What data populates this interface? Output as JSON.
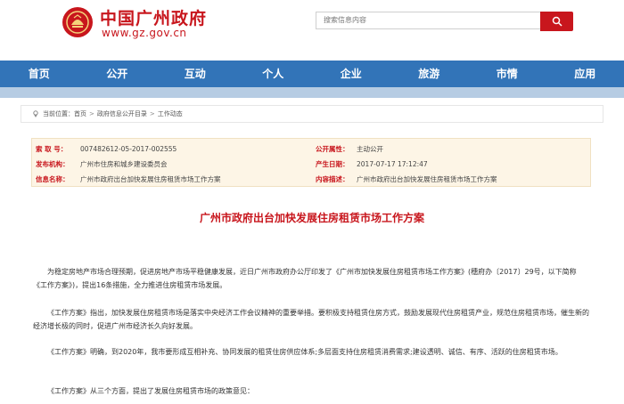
{
  "header": {
    "site_name": "中国广州政府",
    "site_url": "www.gz.gov.cn",
    "search_placeholder": "搜索信息内容"
  },
  "nav": {
    "items": [
      "首页",
      "公开",
      "互动",
      "个人",
      "企业",
      "旅游",
      "市情",
      "应用"
    ]
  },
  "breadcrumb": {
    "label": "当前位置：",
    "items": [
      "首页",
      "政府信息公开目录",
      "工作动态"
    ]
  },
  "meta": {
    "index_label": "索 取 号：",
    "index_value": "007482612-05-2017-002555",
    "publicity_label": "公开属性：",
    "publicity_value": "主动公开",
    "org_label": "发布机构：",
    "org_value": "广州市住房和城乡建设委员会",
    "date_label": "产生日期：",
    "date_value": "2017-07-17 17:12:47",
    "title_label": "信息名称：",
    "title_value": "广州市政府出台加快发展住房租赁市场工作方案",
    "summary_label": "内容描述：",
    "summary_value": "广州市政府出台加快发展住房租赁市场工作方案"
  },
  "article": {
    "title": "广州市政府出台加快发展住房租赁市场工作方案",
    "p1": "为稳定房地产市场合理预期，促进房地产市场平稳健康发展，近日广州市政府办公厅印发了《广州市加快发展住房租赁市场工作方案》(穗府办〔2017〕29号，以下简称《工作方案》)，提出16条措施，全力推进住房租赁市场发展。",
    "p2": "《工作方案》指出，加快发展住房租赁市场是落实中央经济工作会议精神的重要举措。要积极支持租赁住房方式，鼓励发展现代住房租赁产业，规范住房租赁市场，催生新的经济增长极的同时，促进广州市经济长久向好发展。",
    "p3": "《工作方案》明确，到2020年，我市要形成互相补充、协同发展的租赁住房供应体系;多层面支持住房租赁消费需求;建设透明、诚信、有序、活跃的住房租赁市场。",
    "p4": "《工作方案》从三个方面，提出了发展住房租赁市场的政策意见："
  },
  "colors": {
    "brand_red": "#c8161d",
    "nav_blue": "#3274b8",
    "meta_bg": "#fdf5e6"
  }
}
